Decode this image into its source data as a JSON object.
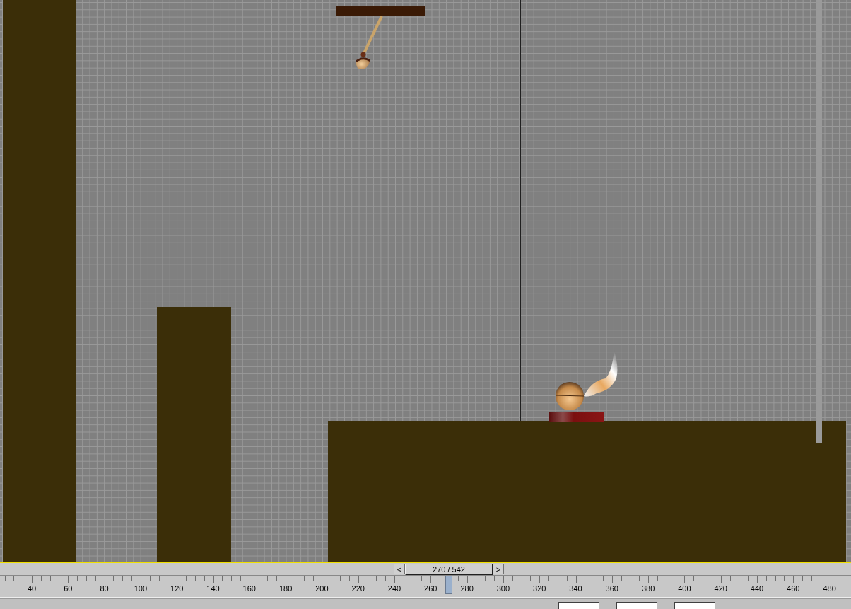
{
  "time_slider": {
    "prev": "<",
    "frame": "270 / 542",
    "next": ">"
  },
  "track_ruler": {
    "labels": [
      "40",
      "60",
      "80",
      "100",
      "120",
      "140",
      "160",
      "180",
      "200",
      "220",
      "240",
      "260",
      "280",
      "300",
      "320",
      "340",
      "360",
      "380",
      "400",
      "420",
      "440",
      "460",
      "480"
    ],
    "level": 0.527
  }
}
